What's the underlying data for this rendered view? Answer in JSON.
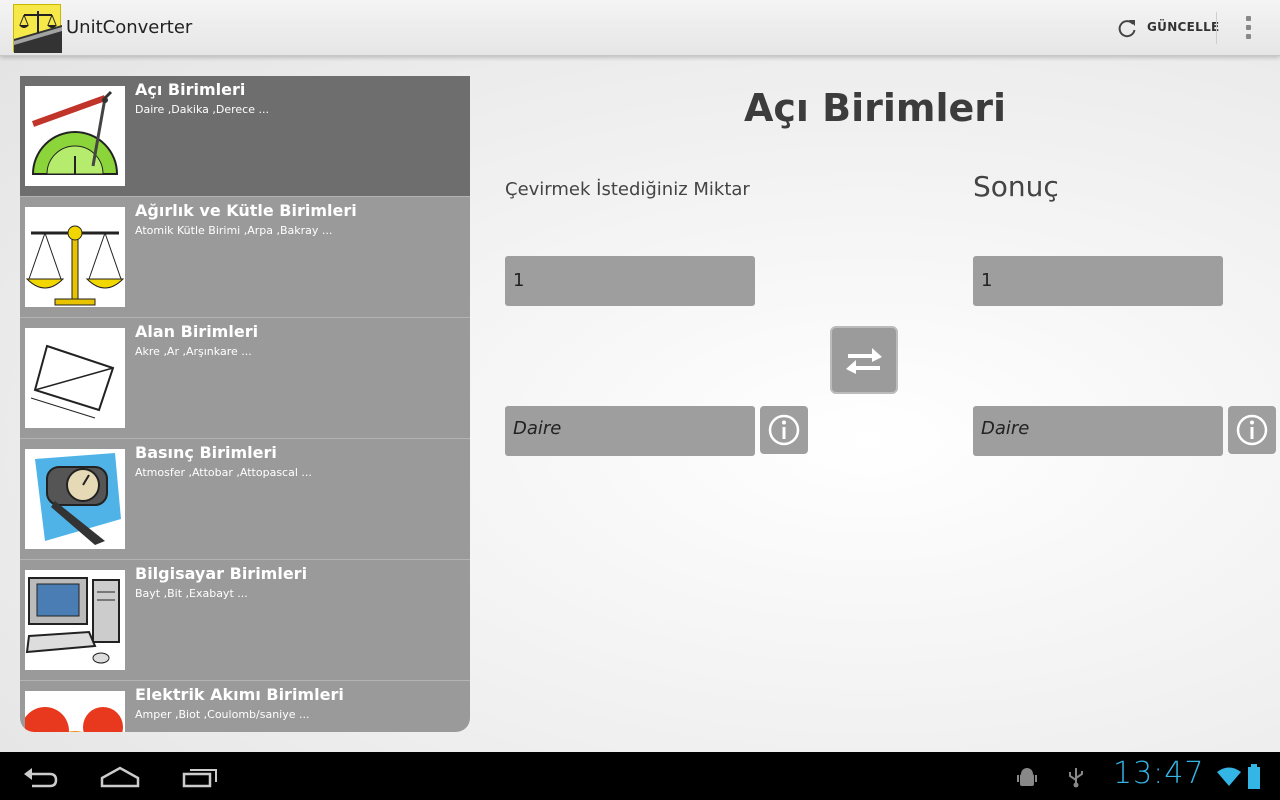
{
  "app": {
    "title": "UnitConverter",
    "refresh_label": "GÜNCELLE"
  },
  "categories": [
    {
      "title": "Açı Birimleri",
      "units": "Daire ,Dakika ,Derece ...",
      "icon": "protractor-compass-icon",
      "selected": true
    },
    {
      "title": "Ağırlık ve Kütle Birimleri",
      "units": "Atomik Kütle Birimi ,Arpa ,Bakray ...",
      "icon": "balance-scale-icon",
      "selected": false
    },
    {
      "title": "Alan Birimleri",
      "units": "Akre ,Ar ,Arşınkare ...",
      "icon": "rectangle-area-icon",
      "selected": false
    },
    {
      "title": "Basınç Birimleri",
      "units": "Atmosfer ,Attobar ,Attopascal ...",
      "icon": "pressure-gauge-icon",
      "selected": false
    },
    {
      "title": "Bilgisayar Birimleri",
      "units": "Bayt ,Bit ,Exabayt ...",
      "icon": "computer-icon",
      "selected": false
    },
    {
      "title": "Elektrik Akımı Birimleri",
      "units": "Amper ,Biot ,Coulomb/saniye ...",
      "icon": "electric-current-icon",
      "selected": false
    }
  ],
  "converter": {
    "title": "Açı Birimleri",
    "input_label": "Çevirmek İstediğiniz Miktar",
    "result_label": "Sonuç",
    "input_value": "1",
    "result_value": "1",
    "from_unit": "Daire",
    "to_unit": "Daire"
  },
  "status": {
    "time": "13:47"
  },
  "colors": {
    "accent": "#33b5e5",
    "selected_item": "#6e6e6e",
    "list_bg": "#9a9a9a",
    "field_bg": "#9e9e9e"
  }
}
